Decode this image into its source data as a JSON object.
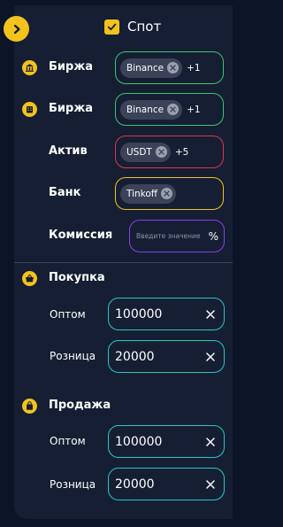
{
  "header": {
    "collapse_icon": "chevron-right-icon",
    "spot_label": "Спот",
    "spot_checked": true
  },
  "filters": [
    {
      "label": "Биржа",
      "icon": "exchange-building-icon",
      "chip": "Binance",
      "more": "+1",
      "border_color": "#39c76a"
    },
    {
      "label": "Биржа",
      "icon": "exchange-building-icon",
      "chip": "Binance",
      "more": "+1",
      "border_color": "#39c76a"
    },
    {
      "label": "Актив",
      "icon": "",
      "chip": "USDT",
      "more": "+5",
      "border_color": "#e0354a"
    },
    {
      "label": "Банк",
      "icon": "",
      "chip": "Tinkoff",
      "more": "",
      "border_color": "#f2c21d"
    }
  ],
  "commission": {
    "label": "Комиссия",
    "placeholder": "Введите значение",
    "unit": "%"
  },
  "buy": {
    "title": "Покупка",
    "wholesale_label": "Оптом",
    "wholesale_value": "100000",
    "retail_label": "Розница",
    "retail_value": "20000"
  },
  "sell": {
    "title": "Продажа",
    "wholesale_label": "Оптом",
    "wholesale_value": "100000",
    "retail_label": "Розница",
    "retail_value": "20000"
  },
  "colors": {
    "accent": "#f2c21d",
    "teal": "#23c9c4",
    "purple": "#8a3ee8",
    "green": "#39c76a",
    "red": "#e0354a",
    "panel": "#161e33",
    "background": "#0c1428"
  }
}
